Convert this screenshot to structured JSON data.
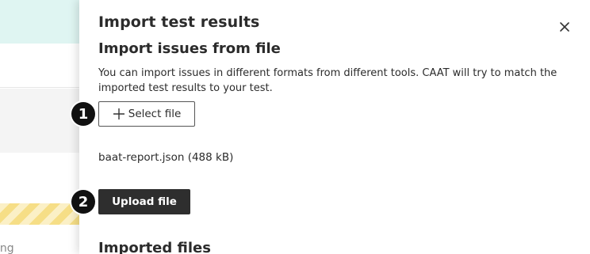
{
  "background": {
    "partial_text": "ing"
  },
  "panel": {
    "title": "Import test results",
    "close_icon": "close-icon",
    "section_title": "Import issues from file",
    "description": "You can import issues in different formats from different tools. CAAT will try to match the imported test results to your test.",
    "steps": [
      {
        "number": "1"
      },
      {
        "number": "2"
      }
    ],
    "select_file": {
      "label": "Select file",
      "icon": "plus-icon"
    },
    "selected_file": "baat-report.json (488 kB)",
    "upload_button": "Upload file",
    "imported_files_title": "Imported files"
  },
  "colors": {
    "primary_button": "#2e2e2e",
    "badge": "#111111",
    "teal_banner": "#dff5f2",
    "stripe_yellow": "#f6de86"
  }
}
